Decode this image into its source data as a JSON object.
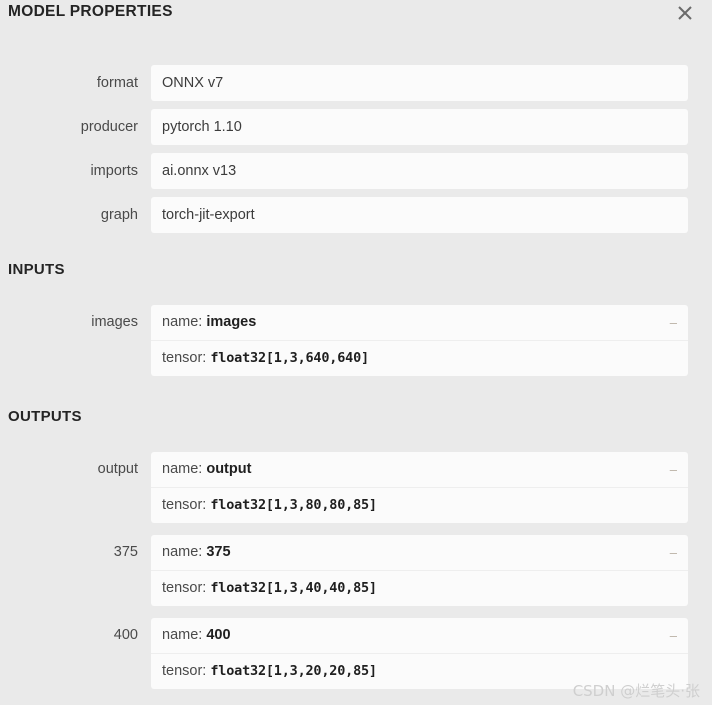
{
  "header": {
    "title": "MODEL PROPERTIES",
    "close_icon": "close-icon"
  },
  "properties": {
    "rows": [
      {
        "label": "format",
        "value": "ONNX v7"
      },
      {
        "label": "producer",
        "value": "pytorch 1.10"
      },
      {
        "label": "imports",
        "value": "ai.onnx v13"
      },
      {
        "label": "graph",
        "value": "torch-jit-export"
      }
    ]
  },
  "inputs": {
    "heading": "INPUTS",
    "items": [
      {
        "label": "images",
        "name_key": "name:",
        "name_value": "images",
        "tensor_key": "tensor:",
        "tensor_value": "float32[1,3,640,640]",
        "collapse_icon": "–"
      }
    ]
  },
  "outputs": {
    "heading": "OUTPUTS",
    "items": [
      {
        "label": "output",
        "name_key": "name:",
        "name_value": "output",
        "tensor_key": "tensor:",
        "tensor_value": "float32[1,3,80,80,85]",
        "collapse_icon": "–"
      },
      {
        "label": "375",
        "name_key": "name:",
        "name_value": "375",
        "tensor_key": "tensor:",
        "tensor_value": "float32[1,3,40,40,85]",
        "collapse_icon": "–"
      },
      {
        "label": "400",
        "name_key": "name:",
        "name_value": "400",
        "tensor_key": "tensor:",
        "tensor_value": "float32[1,3,20,20,85]",
        "collapse_icon": "–"
      }
    ]
  },
  "watermark": {
    "text": "CSDN @烂笔头·张"
  },
  "colors": {
    "background": "#eaeaea",
    "field": "#fbfbfb",
    "text": "#3c3c3c",
    "heading": "#242424"
  }
}
